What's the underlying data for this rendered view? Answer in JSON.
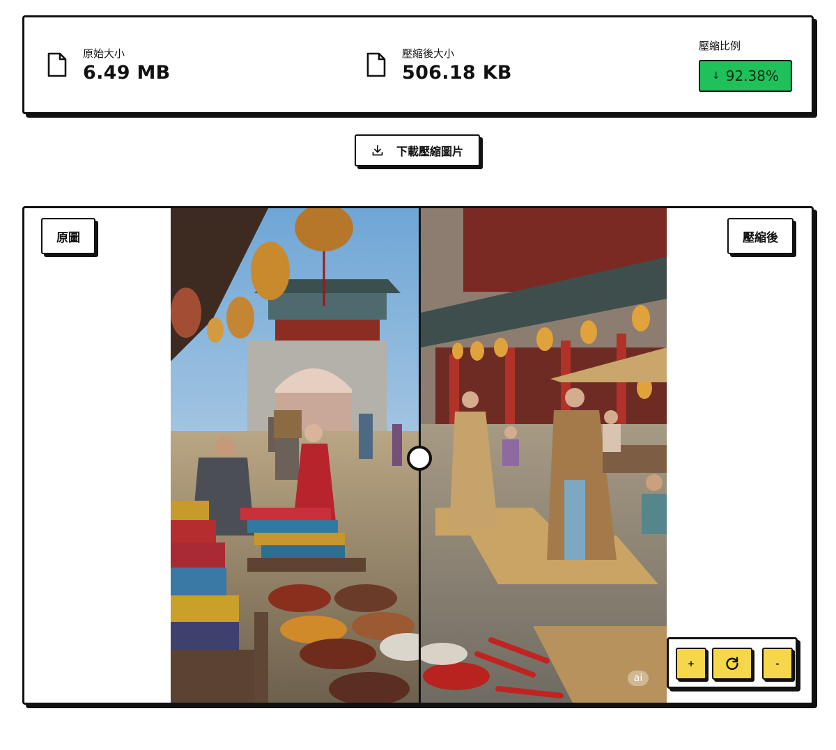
{
  "stats": {
    "original": {
      "label": "原始大小",
      "value": "6.49 MB",
      "icon": "file-icon"
    },
    "compressed": {
      "label": "壓縮後大小",
      "value": "506.18 KB",
      "icon": "file-icon"
    },
    "ratio": {
      "label": "壓縮比例",
      "arrow": "↓",
      "value": "92.38%",
      "color": "#1fc25a"
    }
  },
  "download": {
    "label": "下載壓縮圖片",
    "icon": "download-icon"
  },
  "viewer": {
    "label_original": "原圖",
    "label_compressed": "壓縮後",
    "watermark": "ai",
    "split_fraction": 0.5
  },
  "zoom_controls": {
    "zoom_in": "+",
    "reset_icon": "reset-rotate-icon",
    "zoom_out": "-",
    "button_color": "#f6d64a"
  }
}
